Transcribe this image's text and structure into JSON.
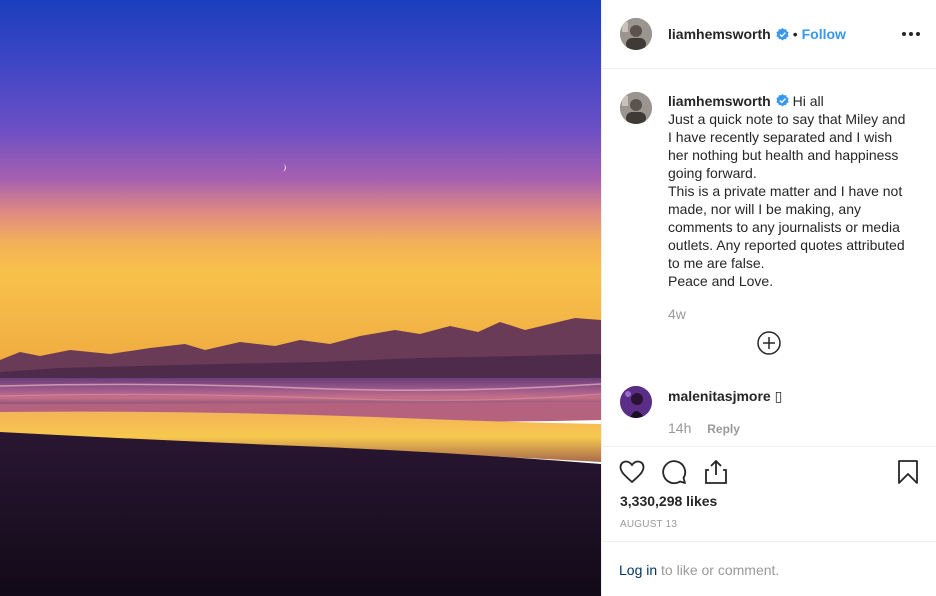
{
  "post": {
    "username": "liamhemsworth",
    "follow_label": "Follow",
    "separator": "•"
  },
  "caption": {
    "username": "liamhemsworth",
    "text": "Hi all\nJust a quick note to say that Miley and I have recently separated and I wish her nothing but health and happiness going forward.\nThis is a private matter and I have not made, nor will I be making, any comments to any journalists or media outlets. Any reported quotes attributed to me are false.\nPeace and Love.",
    "age": "4w"
  },
  "comments": [
    {
      "username": "malenitasjmore",
      "text": "▯",
      "age": "14h",
      "reply_label": "Reply"
    }
  ],
  "likes": "3,330,298 likes",
  "date": "AUGUST 13",
  "login_prompt": {
    "link": "Log in",
    "rest": " to like or comment."
  },
  "icons": {
    "more": "more-options-icon",
    "verified": "verified-badge-icon",
    "load_more": "plus-circle-icon",
    "like": "heart-icon",
    "comment": "comment-bubble-icon",
    "share": "share-icon",
    "save": "bookmark-icon"
  },
  "colors": {
    "link": "#3897f0",
    "verified": "#3897f0",
    "muted": "#999999",
    "login": "#003569"
  }
}
